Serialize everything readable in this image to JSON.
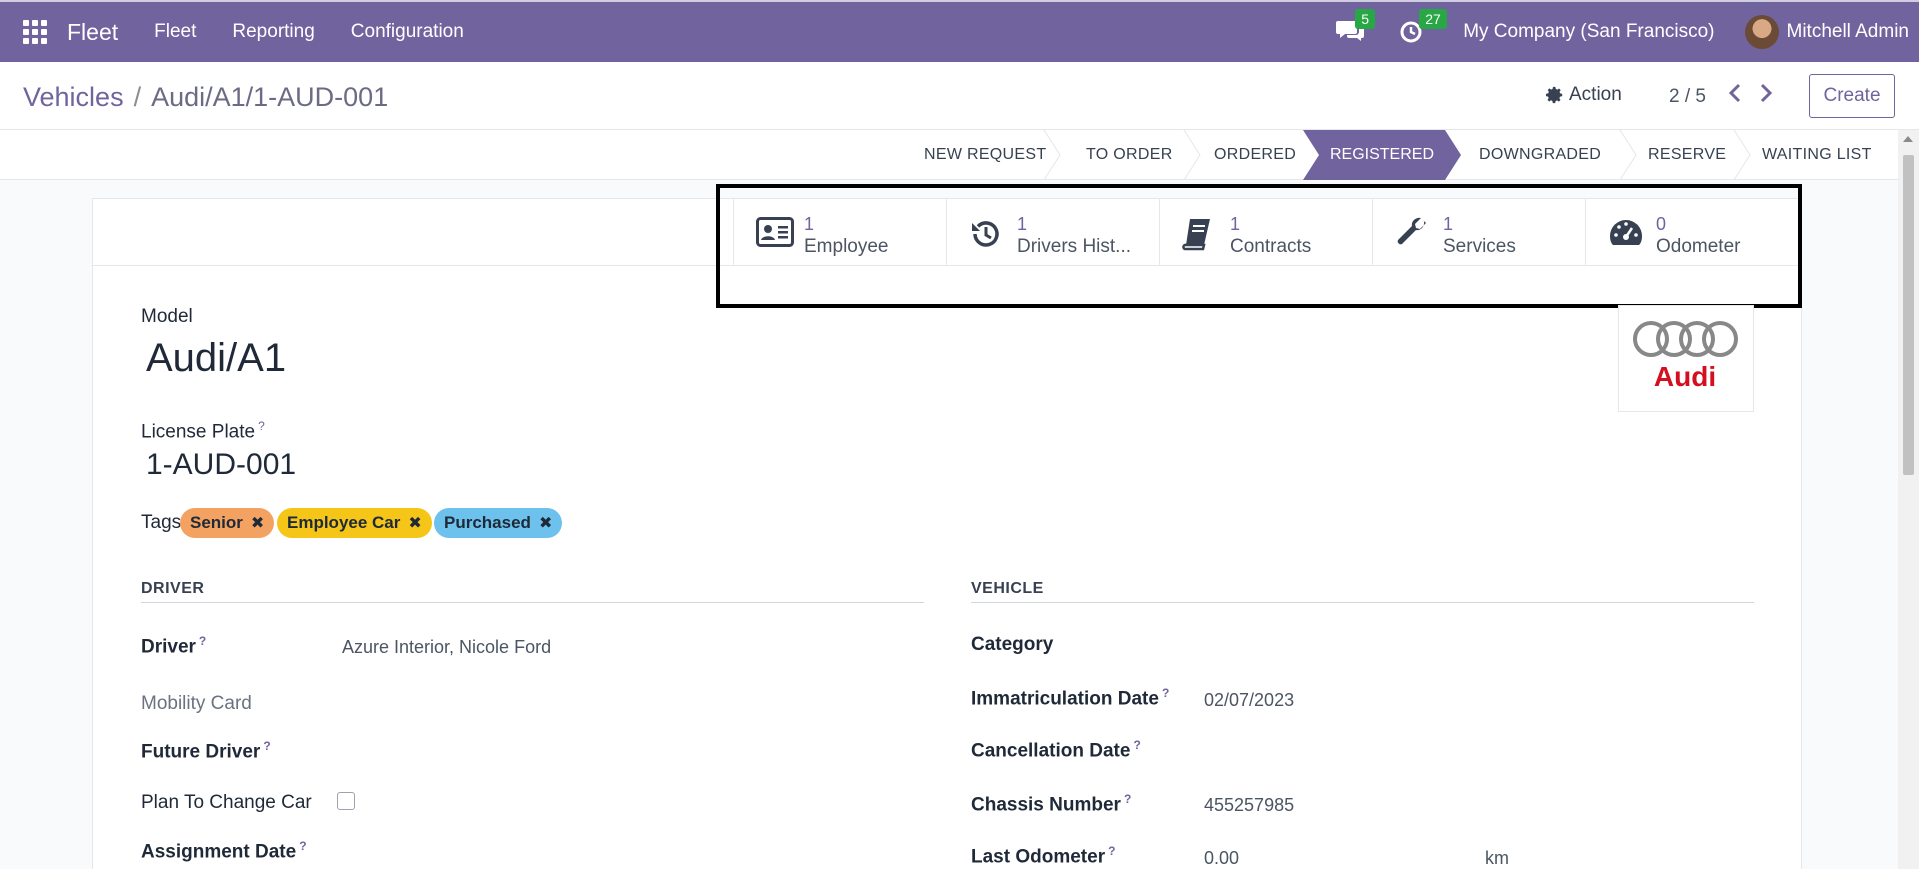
{
  "navbar": {
    "brand": "Fleet",
    "items": [
      "Fleet",
      "Reporting",
      "Configuration"
    ],
    "messages_count": "5",
    "activities_count": "27",
    "company": "My Company (San Francisco)",
    "user": "Mitchell Admin"
  },
  "breadcrumb": {
    "parent": "Vehicles",
    "current": "Audi/A1/1-AUD-001"
  },
  "control": {
    "action_label": "Action",
    "pager": "2 / 5",
    "create_label": "Create"
  },
  "stages": [
    "NEW REQUEST",
    "TO ORDER",
    "ORDERED",
    "REGISTERED",
    "DOWNGRADED",
    "RESERVE",
    "WAITING LIST"
  ],
  "active_stage": "REGISTERED",
  "smart_buttons": [
    {
      "count": "1",
      "label": "Employee",
      "icon": "id-card-icon"
    },
    {
      "count": "1",
      "label": "Drivers Hist...",
      "icon": "history-icon"
    },
    {
      "count": "1",
      "label": "Contracts",
      "icon": "book-icon"
    },
    {
      "count": "1",
      "label": "Services",
      "icon": "wrench-icon"
    },
    {
      "count": "0",
      "label": "Odometer",
      "icon": "tachometer-icon"
    }
  ],
  "form": {
    "model_label": "Model",
    "model_value": "Audi/A1",
    "plate_label": "License Plate",
    "plate_value": "1-AUD-001",
    "help_mark": "?",
    "tags_label": "Tags",
    "tags": [
      {
        "name": "Senior",
        "color": "#f4a261"
      },
      {
        "name": "Employee Car",
        "color": "#f5c518"
      },
      {
        "name": "Purchased",
        "color": "#6cc1ed"
      }
    ],
    "logo_text": "Audi",
    "driver_section": {
      "title": "DRIVER",
      "driver_label": "Driver",
      "driver_value": "Azure Interior, Nicole Ford",
      "mobility_label": "Mobility Card",
      "future_driver_label": "Future Driver",
      "plan_change_label": "Plan To Change Car",
      "assignment_label": "Assignment Date"
    },
    "vehicle_section": {
      "title": "VEHICLE",
      "category_label": "Category",
      "immat_label": "Immatriculation Date",
      "immat_value": "02/07/2023",
      "cancel_label": "Cancellation Date",
      "chassis_label": "Chassis Number",
      "chassis_value": "455257985",
      "odometer_label": "Last Odometer",
      "odometer_value": "0.00",
      "odometer_unit": "km"
    }
  },
  "colors": {
    "primary": "#71639e",
    "highlight_border": "#000000"
  }
}
